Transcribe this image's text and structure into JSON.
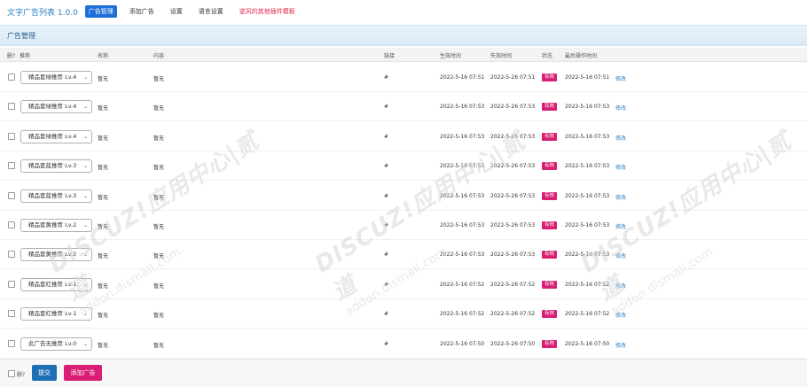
{
  "header": {
    "title": "文字广告列表",
    "version": "1.0.0",
    "nav": [
      {
        "label": "广告管理",
        "active": true
      },
      {
        "label": "添加广告",
        "active": false
      },
      {
        "label": "设置",
        "active": false
      },
      {
        "label": "语言设置",
        "active": false
      },
      {
        "label": "逆风的其他插件模板",
        "active": false,
        "highlight": true
      }
    ]
  },
  "section": {
    "title": "广告管理"
  },
  "columns": {
    "del": "删?",
    "recommend": "推荐",
    "name": "名称",
    "content": "内容",
    "link": "链接",
    "start": "生效时间",
    "end": "失效时间",
    "status": "状态",
    "last_op": "最后操作时间"
  },
  "rows": [
    {
      "recommend": "精品套绿推荐 Lv.4",
      "name": "暂无",
      "content": "暂无",
      "link": "#",
      "start": "2022-5-16 07:51",
      "end": "2022-5-26 07:51",
      "status": "有效",
      "last_op": "2022-5-16 07:51",
      "edit": "修改"
    },
    {
      "recommend": "精品套绿推荐 Lv.4",
      "name": "暂无",
      "content": "暂无",
      "link": "#",
      "start": "2022-5-16 07:53",
      "end": "2022-5-26 07:53",
      "status": "有效",
      "last_op": "2022-5-16 07:53",
      "edit": "修改"
    },
    {
      "recommend": "精品套绿推荐 Lv.4",
      "name": "暂无",
      "content": "暂无",
      "link": "#",
      "start": "2022-5-16 07:53",
      "end": "2022-5-26 07:53",
      "status": "有效",
      "last_op": "2022-5-16 07:53",
      "edit": "修改"
    },
    {
      "recommend": "精品套蓝推荐 Lv.3",
      "name": "暂无",
      "content": "暂无",
      "link": "#",
      "start": "2022-5-16 07:53",
      "end": "2022-5-26 07:53",
      "status": "有效",
      "last_op": "2022-5-16 07:53",
      "edit": "修改"
    },
    {
      "recommend": "精品套蓝推荐 Lv.3",
      "name": "暂无",
      "content": "暂无",
      "link": "#",
      "start": "2022-5-16 07:53",
      "end": "2022-5-26 07:53",
      "status": "有效",
      "last_op": "2022-5-16 07:53",
      "edit": "修改"
    },
    {
      "recommend": "精品套黄推荐 Lv.2",
      "name": "暂无",
      "content": "暂无",
      "link": "#",
      "start": "2022-5-16 07:53",
      "end": "2022-5-26 07:53",
      "status": "有效",
      "last_op": "2022-5-16 07:53",
      "edit": "修改"
    },
    {
      "recommend": "精品套黄推荐 Lv.2",
      "name": "暂无",
      "content": "暂无",
      "link": "#",
      "start": "2022-5-16 07:53",
      "end": "2022-5-26 07:53",
      "status": "有效",
      "last_op": "2022-5-16 07:53",
      "edit": "修改"
    },
    {
      "recommend": "精品套红推荐 Lv.1",
      "name": "暂无",
      "content": "暂无",
      "link": "#",
      "start": "2022-5-16 07:52",
      "end": "2022-5-26 07:52",
      "status": "有效",
      "last_op": "2022-5-16 07:52",
      "edit": "修改"
    },
    {
      "recommend": "精品套红推荐 Lv.1",
      "name": "暂无",
      "content": "暂无",
      "link": "#",
      "start": "2022-5-16 07:52",
      "end": "2022-5-26 07:52",
      "status": "有效",
      "last_op": "2022-5-16 07:52",
      "edit": "修改"
    },
    {
      "recommend": "此广告无推荐 Lv.0",
      "name": "暂无",
      "content": "暂无",
      "link": "#",
      "start": "2022-5-16 07:50",
      "end": "2022-5-26 07:50",
      "status": "有效",
      "last_op": "2022-5-16 07:50",
      "edit": "修改"
    }
  ],
  "footer": {
    "del_label": "删?",
    "submit": "提交",
    "add": "添加广告"
  },
  "watermark": {
    "main": "DISCUZ!应用中心|贰道",
    "sub": "addon.dismall.com"
  },
  "colors": {
    "accent": "#1e6fd9",
    "badge": "#d81e75",
    "link": "#2b7fc3",
    "danger": "#e5264b"
  }
}
